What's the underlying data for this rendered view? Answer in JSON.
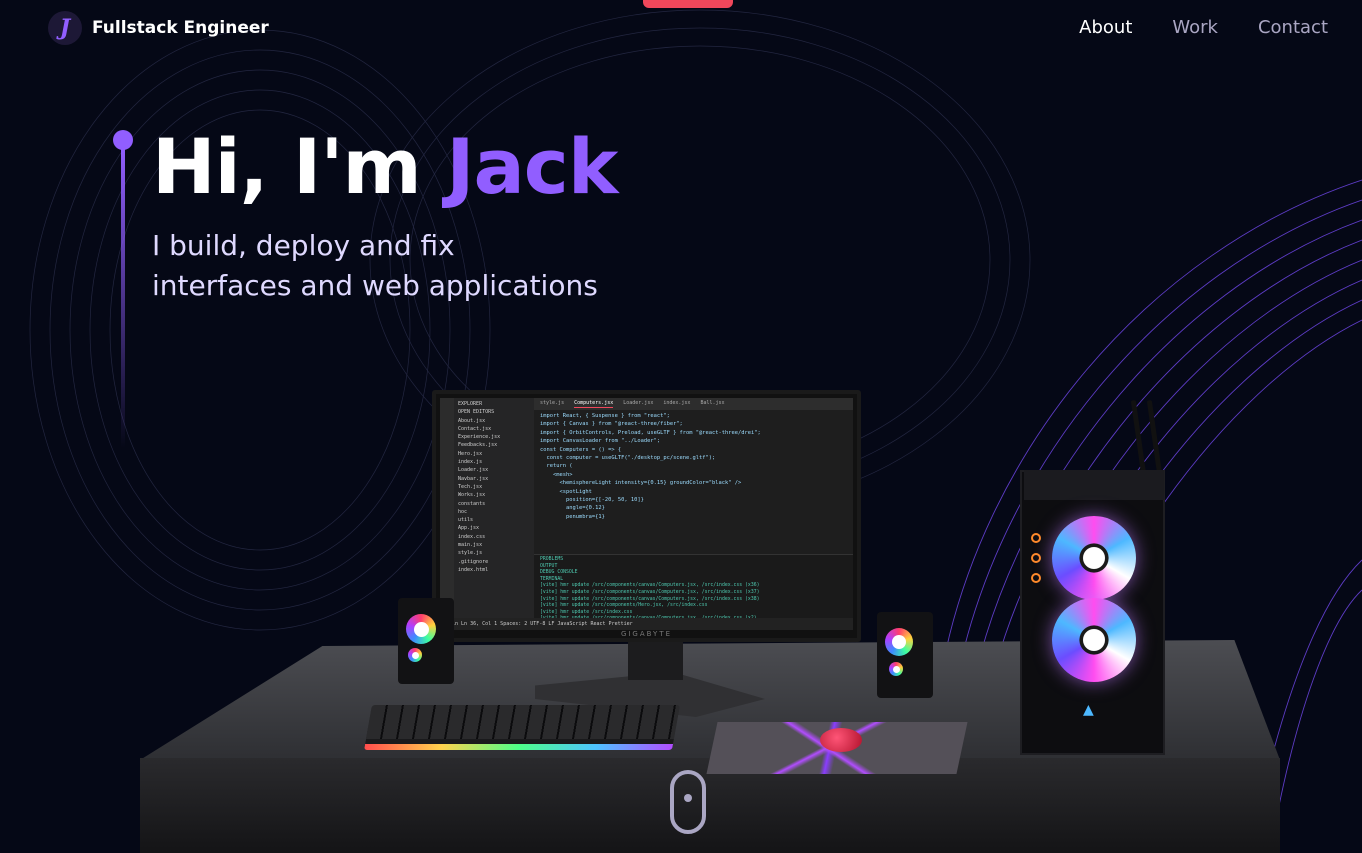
{
  "nav": {
    "logo_letter": "J",
    "logo_text": "Fullstack Engineer",
    "links": [
      "About",
      "Work",
      "Contact"
    ]
  },
  "hero": {
    "greeting": "Hi, I'm",
    "name": "Jack",
    "subtitle_line1": "I build, deploy and fix",
    "subtitle_line2": "interfaces and web applications"
  },
  "colors": {
    "background": "#050816",
    "accent": "#915eff",
    "secondary_text": "#aaa6c3",
    "notch": "#f0475b"
  },
  "monitor": {
    "brand": "GIGABYTE",
    "tabs": [
      "style.js",
      "Computers.jsx",
      "Loader.jsx",
      "index.jsx",
      "Ball.jsx"
    ],
    "explorer": [
      "EXPLORER",
      "OPEN EDITORS",
      "About.jsx",
      "Contact.jsx",
      "Experience.jsx",
      "Feedbacks.jsx",
      "Hero.jsx",
      "index.js",
      "Loader.jsx",
      "Navbar.jsx",
      "Tech.jsx",
      "Works.jsx",
      "constants",
      "hoc",
      "utils",
      "App.jsx",
      "index.css",
      "main.jsx",
      "style.js",
      ".gitignore",
      "index.html"
    ],
    "code": [
      "import React, { Suspense } from \"react\";",
      "import { Canvas } from \"@react-three/fiber\";",
      "import { OrbitControls, Preload, useGLTF } from \"@react-three/drei\";",
      "",
      "import CanvasLoader from \"../Loader\";",
      "",
      "const Computers = () => {",
      "  const computer = useGLTF(\"./desktop_pc/scene.gltf\");",
      "",
      "  return (",
      "    <mesh>",
      "      <hemisphereLight intensity={0.15} groundColor=\"black\" />",
      "      <spotLight",
      "        position={[-20, 50, 10]}",
      "        angle={0.12}",
      "        penumbra={1}"
    ],
    "panel_tabs": [
      "PROBLEMS",
      "OUTPUT",
      "DEBUG CONSOLE",
      "TERMINAL"
    ],
    "terminal": [
      "[vite] hmr update /src/components/canvas/Computers.jsx, /src/index.css (x36)",
      "[vite] hmr update /src/components/canvas/Computers.jsx, /src/index.css (x37)",
      "[vite] hmr update /src/components/canvas/Computers.jsx, /src/index.css (x38)",
      "[vite] hmr update /src/components/Hero.jsx, /src/index.css",
      "[vite] hmr update /src/index.css",
      "[vite] hmr update /src/components/canvas/Computers.jsx, /src/index.css (x2)",
      "[vite] hmr update /src/components/canvas/Computers.jsx, /src/index.css (x3)"
    ],
    "status": "main   Ln 36, Col 1   Spaces: 2   UTF-8   LF   JavaScript React   Prettier"
  }
}
